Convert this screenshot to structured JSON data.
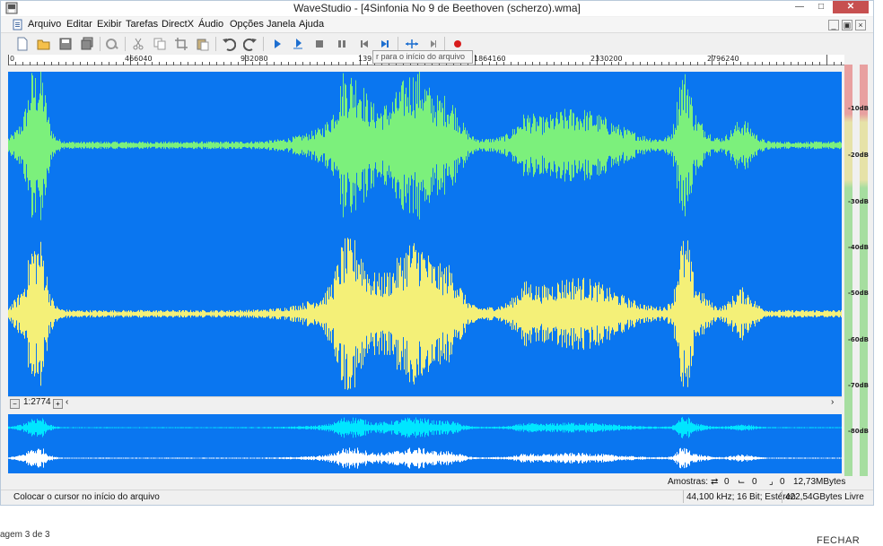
{
  "window": {
    "title": "WaveStudio - [4Sinfonia No 9 de Beethoven (scherzo).wma]"
  },
  "menu": [
    "Arquivo",
    "Editar",
    "Exibir",
    "Tarefas",
    "DirectX",
    "Áudio",
    "Opções",
    "Janela",
    "Ajuda"
  ],
  "toolbar": {
    "tooltip": "r para o início do arquivo",
    "buttons": [
      "new-file-icon",
      "open-folder-icon",
      "save-icon",
      "save-all-icon",
      "properties-icon",
      "cut-icon",
      "copy-icon",
      "crop-icon",
      "paste-icon",
      "undo-icon",
      "redo-icon",
      "play-icon",
      "loop-play-icon",
      "stop-icon",
      "pause-icon",
      "go-to-start-icon",
      "go-to-end-icon",
      "select-to-cursor-icon",
      "next-marker-icon",
      "record-icon"
    ]
  },
  "ruler": {
    "labels": [
      "0",
      "466040",
      "932080",
      "1398",
      "1864160",
      "2330200",
      "2796240"
    ]
  },
  "waveform": {
    "colors": {
      "background": "#0a76f0",
      "left_channel": "#7cf07c",
      "right_channel": "#f4f078",
      "overview_left": "#00e6ff",
      "overview_right": "#ffffff"
    }
  },
  "zoom": {
    "value": "1:2774"
  },
  "vu_meter": {
    "labels": [
      "-10dB",
      "-20dB",
      "-30dB",
      "-40dB",
      "-50dB",
      "-60dB",
      "-70dB",
      "-80dB"
    ]
  },
  "status": {
    "samples_label": "Amostras:",
    "sel_start": "0",
    "sel_length": "0",
    "sel_end": "0",
    "file_size": "12,73MBytes",
    "hint": "Colocar o cursor no início do arquivo",
    "format": "44,100 kHz; 16 Bit; Estéreo",
    "free_space": "422,54GBytes Livre"
  },
  "page": {
    "footer_left": "agem 3 de 3",
    "footer_right": "FECHAR"
  }
}
